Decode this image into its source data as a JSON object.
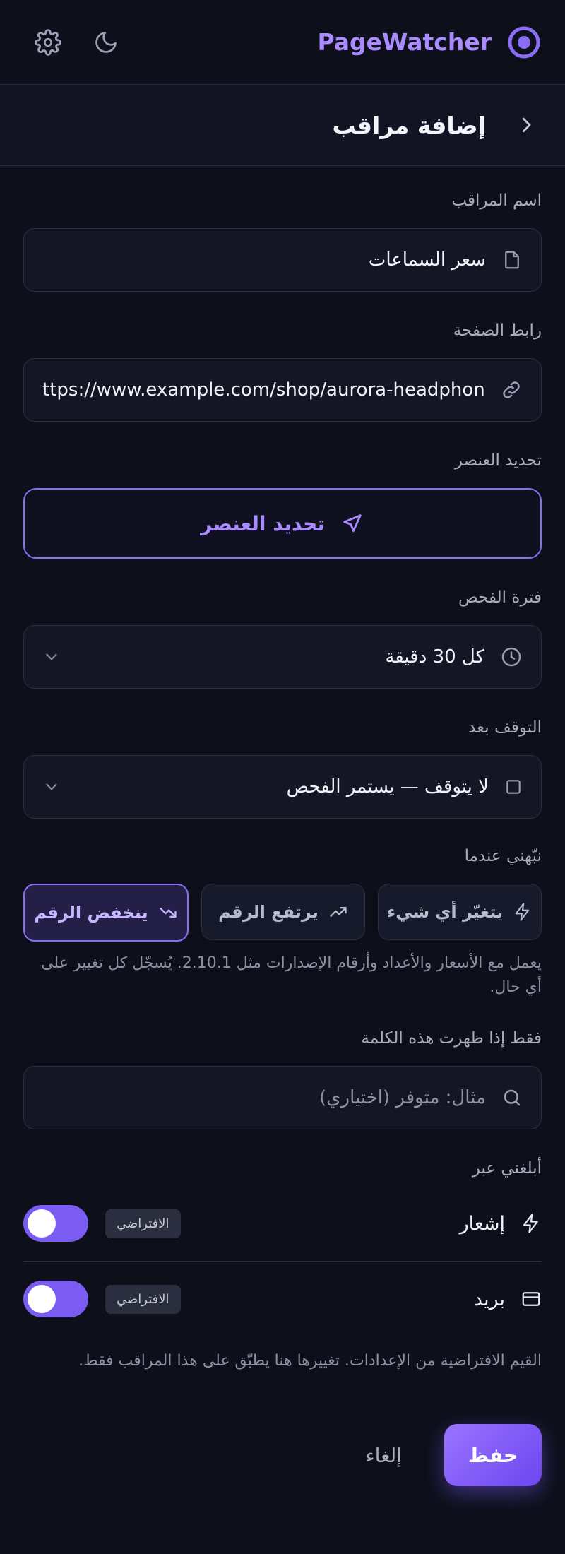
{
  "app": {
    "name": "PageWatcher"
  },
  "page": {
    "title": "إضافة مراقب"
  },
  "form": {
    "name": {
      "label": "اسم المراقب",
      "value": "سعر السماعات"
    },
    "url": {
      "label": "رابط الصفحة",
      "value": "ttps://www.example.com/shop/aurora-headphones"
    },
    "element": {
      "label": "تحديد العنصر",
      "button_label": "تحديد العنصر"
    },
    "interval": {
      "label": "فترة الفحص",
      "value": "كل 30 دقيقة"
    },
    "stop": {
      "label": "التوقف بعد",
      "value": "لا يتوقف — يستمر الفحص"
    },
    "alert": {
      "label": "نبّهني عندما",
      "options": [
        {
          "label": "يتغيّر أي شيء",
          "icon": "lightning-icon"
        },
        {
          "label": "يرتفع الرقم",
          "icon": "trending-up-icon"
        },
        {
          "label": "ينخفض الرقم",
          "icon": "trending-down-icon"
        }
      ],
      "selected": "ينخفض الرقم",
      "help": "يعمل مع الأسعار والأعداد وأرقام الإصدارات مثل 2.10.1. يُسجّل كل تغيير على أي حال."
    },
    "keyword": {
      "label": "فقط إذا ظهرت هذه الكلمة",
      "placeholder": "مثال: متوفر (اختياري)"
    },
    "notify": {
      "label": "أبلغني عبر",
      "channels": [
        {
          "name": "إشعار",
          "badge": "الافتراضي",
          "enabled": true,
          "icon": "lightning-icon"
        },
        {
          "name": "بريد",
          "badge": "الافتراضي",
          "enabled": true,
          "icon": "card-icon"
        }
      ],
      "help": "القيم الافتراضية من الإعدادات. تغييرها هنا يطبّق على هذا المراقب فقط."
    }
  },
  "actions": {
    "save": "حفظ",
    "cancel": "إلغاء"
  },
  "colors": {
    "accent": "#7b5cf2",
    "brand": "#a98bff",
    "background": "#0d0f1a"
  }
}
